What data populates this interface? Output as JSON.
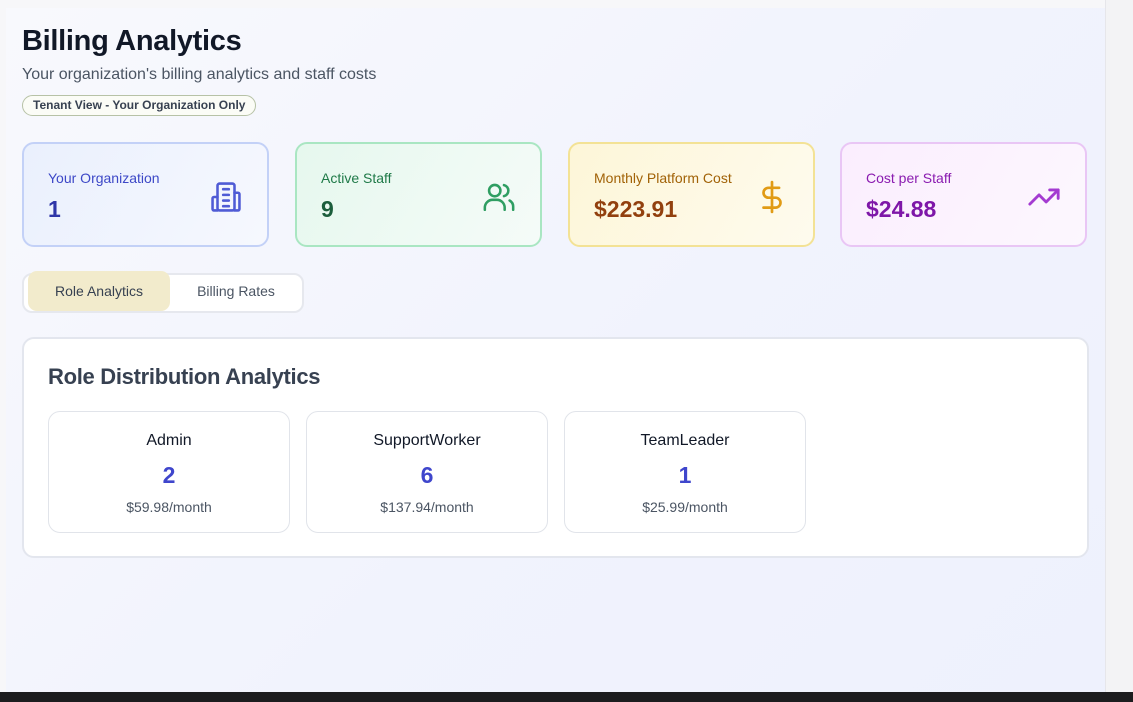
{
  "header": {
    "title": "Billing Analytics",
    "subtitle": "Your organization's billing analytics and staff costs",
    "badge": "Tenant View - Your Organization Only"
  },
  "stats": [
    {
      "label": "Your Organization",
      "value": "1",
      "icon": "building-icon",
      "color": "#3d48c7"
    },
    {
      "label": "Active Staff",
      "value": "9",
      "icon": "users-icon",
      "color": "#1f7a48"
    },
    {
      "label": "Monthly Platform Cost",
      "value": "$223.91",
      "icon": "dollar-icon",
      "color": "#d97706"
    },
    {
      "label": "Cost per Staff",
      "value": "$24.88",
      "icon": "trending-up-icon",
      "color": "#8a1bb0"
    }
  ],
  "tabs": [
    {
      "label": "Role Analytics",
      "active": true
    },
    {
      "label": "Billing Rates",
      "active": false
    }
  ],
  "panel": {
    "title": "Role Distribution Analytics",
    "roles": [
      {
        "name": "Admin",
        "count": "2",
        "cost": "$59.98/month"
      },
      {
        "name": "SupportWorker",
        "count": "6",
        "cost": "$137.94/month"
      },
      {
        "name": "TeamLeader",
        "count": "1",
        "cost": "$25.99/month"
      }
    ]
  }
}
